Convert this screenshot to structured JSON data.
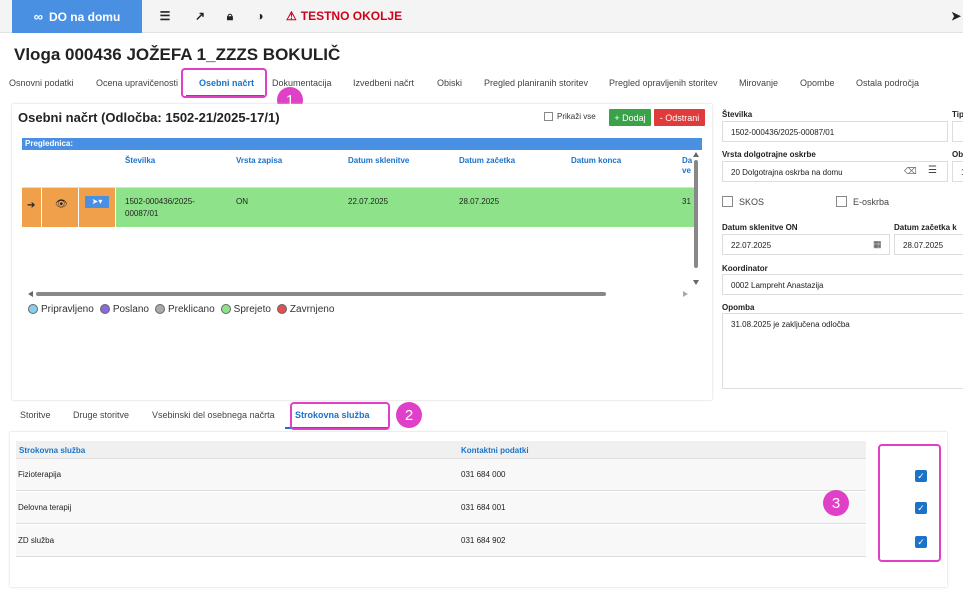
{
  "app": {
    "name": "DO na domu",
    "env_warning": "TESTNO OKOLJE"
  },
  "page_title": "Vloga 000436 JOŽEFA 1_ZZZS BOKULIČ",
  "main_tabs": [
    "Osnovni podatki",
    "Ocena upravičenosti",
    "Osebni načrt",
    "Dokumentacija",
    "Izvedbeni načrt",
    "Obiski",
    "Pregled planiranih storitev",
    "Pregled opravljenih storitev",
    "Mirovanje",
    "Opombe",
    "Ostala področja"
  ],
  "annotations": [
    "1",
    "2",
    "3"
  ],
  "plan": {
    "title": "Osebni načrt (Odločba: 1502-21/2025-17/1)",
    "show_all_label": "Prikaži vse",
    "add_label": "+ Dodaj",
    "remove_label": "- Odstrani",
    "overview_label": "Preglednica:",
    "columns": [
      "Številka",
      "Vrsta zapisa",
      "Datum sklenitve",
      "Datum začetka",
      "Datum konca",
      "Da ve"
    ],
    "row": {
      "stevilka": "1502-000436/2025-00087/01",
      "vrsta": "ON",
      "datum_sklenitve": "22.07.2025",
      "datum_zacetka": "28.07.2025",
      "datum_konca": "",
      "extra": "31"
    },
    "legend": [
      "Pripravljeno",
      "Poslano",
      "Preklicano",
      "Sprejeto",
      "Zavrnjeno"
    ],
    "legend_colors": [
      "#87ceeb",
      "#8a6ad8",
      "#aaaaaa",
      "#8ee38a",
      "#e05050"
    ]
  },
  "details": {
    "stevilka_label": "Številka",
    "stevilka_value": "1502-000436/2025-00087/01",
    "tip_label": "Tip",
    "vrsta_label": "Vrsta dolgotrajne oskrbe",
    "vrsta_value": "20 Dolgotrajna oskrba na domu",
    "ob_label": "Ob",
    "ob_value": "1",
    "skos_label": "SKOS",
    "eoskrba_label": "E-oskrba",
    "datum_sklenitve_label": "Datum sklenitve ON",
    "datum_sklenitve_value": "22.07.2025",
    "datum_zacetka_label": "Datum začetka k",
    "datum_zacetka_value": "28.07.2025",
    "koordinator_label": "Koordinator",
    "koordinator_value": "0002 Lampreht Anastazija",
    "opomba_label": "Opomba",
    "opomba_value": "31.08.2025 je zaključena odločba"
  },
  "sub_tabs": [
    "Storitve",
    "Druge storitve",
    "Vsebinski del osebnega načrta",
    "Strokovna služba"
  ],
  "services": {
    "columns": [
      "Strokovna služba",
      "Kontaktni podatki"
    ],
    "rows": [
      {
        "name": "Fizioterapija",
        "contact": "031 684 000",
        "checked": true
      },
      {
        "name": "Delovna terapij",
        "contact": "031 684 001",
        "checked": true
      },
      {
        "name": "ZD služba",
        "contact": "031 684 902",
        "checked": true
      }
    ]
  }
}
